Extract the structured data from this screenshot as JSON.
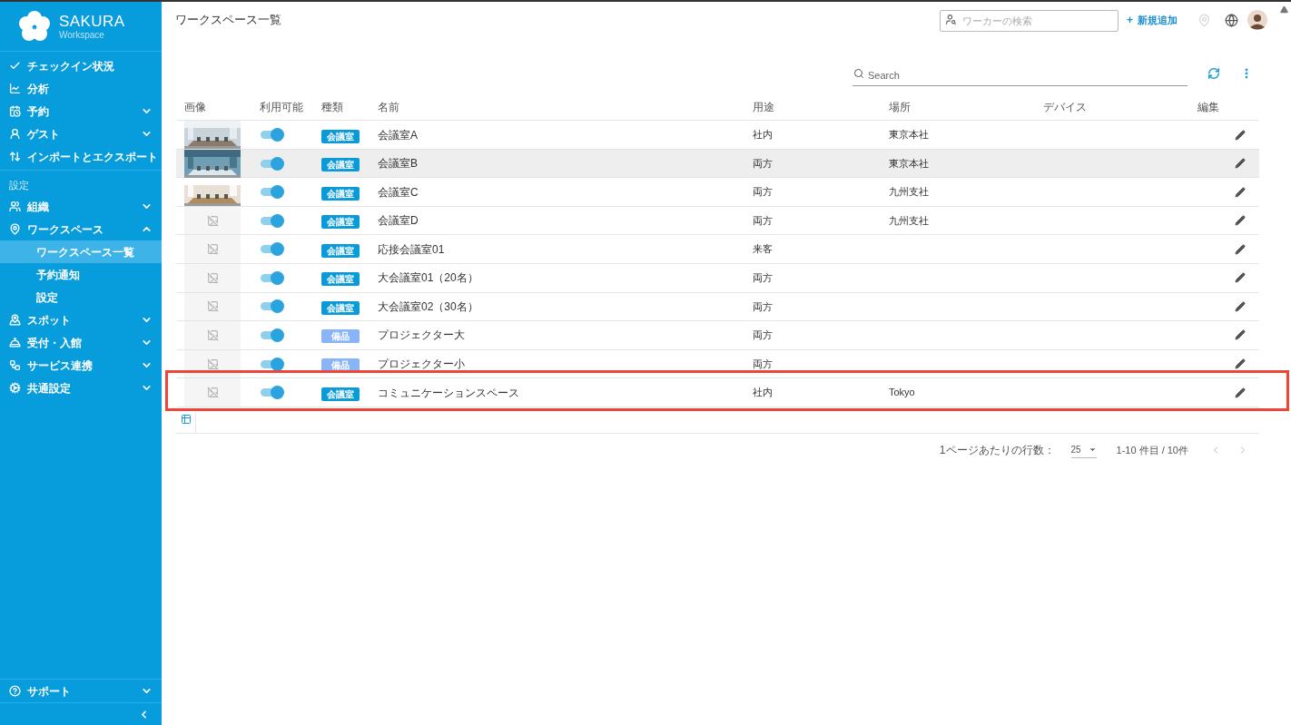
{
  "brand": {
    "name": "SAKURA",
    "sub": "Workspace"
  },
  "sidebar": {
    "items": [
      {
        "label": "チェックイン状況"
      },
      {
        "label": "分析"
      },
      {
        "label": "予約",
        "expanded": false
      },
      {
        "label": "ゲスト",
        "expanded": false
      },
      {
        "label": "インポートとエクスポート"
      }
    ],
    "section": "設定",
    "settings": [
      {
        "label": "組織",
        "expanded": false
      },
      {
        "label": "ワークスペース",
        "expanded": true,
        "children": [
          {
            "label": "ワークスペース一覧",
            "selected": true
          },
          {
            "label": "予約通知",
            "selected": false
          },
          {
            "label": "設定",
            "selected": false
          }
        ]
      },
      {
        "label": "スポット",
        "expanded": false
      },
      {
        "label": "受付・入館",
        "expanded": false
      },
      {
        "label": "サービス連携",
        "expanded": false
      },
      {
        "label": "共通設定",
        "expanded": false
      }
    ],
    "footer": {
      "label": "サポート",
      "expanded": false
    }
  },
  "header": {
    "title": "ワークスペース一覧",
    "worker_search": {
      "placeholder": "ワーカーの検索"
    },
    "add": {
      "icon": "+",
      "label": "新規追加"
    }
  },
  "table": {
    "search": {
      "placeholder": "Search"
    },
    "columns": [
      "画像",
      "利用可能",
      "種類",
      "名前",
      "用途",
      "場所",
      "デバイス",
      "編集"
    ],
    "rows": [
      {
        "photo": true,
        "available": true,
        "type": {
          "kind": "room",
          "label": "会議室"
        },
        "name": "会議室A",
        "usage": "社内",
        "place": "東京本社",
        "hovered": false,
        "outlined": false
      },
      {
        "photo": true,
        "available": true,
        "type": {
          "kind": "room",
          "label": "会議室"
        },
        "name": "会議室B",
        "usage": "両方",
        "place": "東京本社",
        "hovered": true,
        "outlined": false
      },
      {
        "photo": true,
        "available": true,
        "type": {
          "kind": "room",
          "label": "会議室"
        },
        "name": "会議室C",
        "usage": "両方",
        "place": "九州支社",
        "hovered": false,
        "outlined": false
      },
      {
        "photo": false,
        "available": true,
        "type": {
          "kind": "room",
          "label": "会議室"
        },
        "name": "会議室D",
        "usage": "両方",
        "place": "九州支社",
        "hovered": false,
        "outlined": false
      },
      {
        "photo": false,
        "available": true,
        "type": {
          "kind": "room",
          "label": "会議室"
        },
        "name": "応接会議室01",
        "usage": "来客",
        "hovered": false,
        "outlined": false
      },
      {
        "photo": false,
        "available": true,
        "type": {
          "kind": "room",
          "label": "会議室"
        },
        "name": "大会議室01（20名）",
        "usage": "両方",
        "hovered": false,
        "outlined": false
      },
      {
        "photo": false,
        "available": true,
        "type": {
          "kind": "room",
          "label": "会議室"
        },
        "name": "大会議室02（30名）",
        "usage": "両方",
        "hovered": false,
        "outlined": false
      },
      {
        "photo": false,
        "available": true,
        "type": {
          "kind": "equipment",
          "label": "備品"
        },
        "name": "プロジェクター大",
        "usage": "両方",
        "hovered": false,
        "outlined": false
      },
      {
        "photo": false,
        "available": true,
        "type": {
          "kind": "equipment",
          "label": "備品"
        },
        "name": "プロジェクター小",
        "usage": "両方",
        "hovered": false,
        "outlined": false
      },
      {
        "photo": false,
        "available": true,
        "type": {
          "kind": "room",
          "label": "会議室"
        },
        "name": "コミュニケーションスペース",
        "usage": "社内",
        "place": "Tokyo",
        "hovered": false,
        "outlined": true
      }
    ]
  },
  "pagination": {
    "rows_label": "1ページあたりの行数：",
    "rows_value": "25",
    "range": "1-10 件目 / 10件"
  }
}
